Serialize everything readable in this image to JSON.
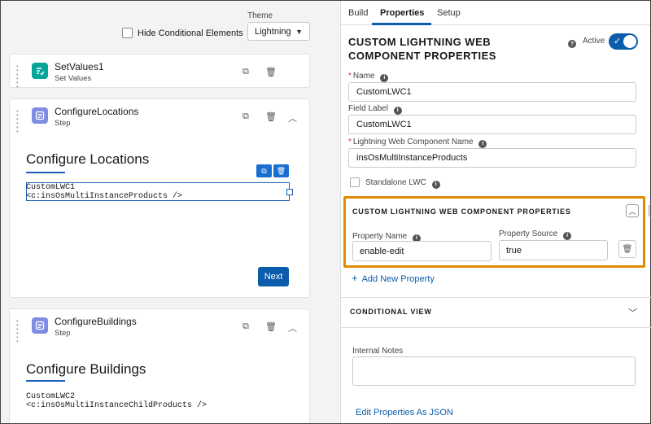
{
  "canvas": {
    "hide_conditional_label": "Hide Conditional Elements",
    "theme_label": "Theme",
    "theme_value": "Lightning",
    "elements": [
      {
        "title": "SetValues1",
        "subtitle": "Set Values",
        "icon": "set-values-icon",
        "icon_color": "#06a59a"
      },
      {
        "title": "ConfigureLocations",
        "subtitle": "Step",
        "icon": "step-icon",
        "icon_color": "#7f8de1",
        "heading": "Configure Locations",
        "lwc_line1": "CustomLWC1",
        "lwc_line2": "<c:insOsMultiInstanceProducts />",
        "next_label": "Next"
      },
      {
        "title": "ConfigureBuildings",
        "subtitle": "Step",
        "icon": "step-icon",
        "icon_color": "#7f8de1",
        "heading": "Configure Buildings",
        "lwc_line1": "CustomLWC2",
        "lwc_line2": "<c:insOsMultiInstanceChildProducts />"
      }
    ]
  },
  "panel": {
    "tabs": [
      "Build",
      "Properties",
      "Setup"
    ],
    "active_tab": "Properties",
    "title": "CUSTOM LIGHTNING WEB COMPONENT PROPERTIES",
    "active_label": "Active",
    "accent": "#0b5cab",
    "name_label": "Name",
    "name_value": "CustomLWC1",
    "field_label_label": "Field Label",
    "field_label_value": "CustomLWC1",
    "lwc_name_label": "Lightning Web Component Name",
    "lwc_name_value": "insOsMultiInstanceProducts",
    "standalone_label": "Standalone LWC",
    "custom_props": {
      "title": "CUSTOM LIGHTNING WEB COMPONENT PROPERTIES",
      "property_name_label": "Property Name",
      "property_source_label": "Property Source",
      "property_name_value": "enable-edit",
      "property_source_value": "true",
      "highlight_color": "#e08a00"
    },
    "add_property_label": "Add New Property",
    "conditional_view_label": "CONDITIONAL VIEW",
    "internal_notes_label": "Internal Notes",
    "edit_json_label": "Edit Properties As JSON"
  }
}
